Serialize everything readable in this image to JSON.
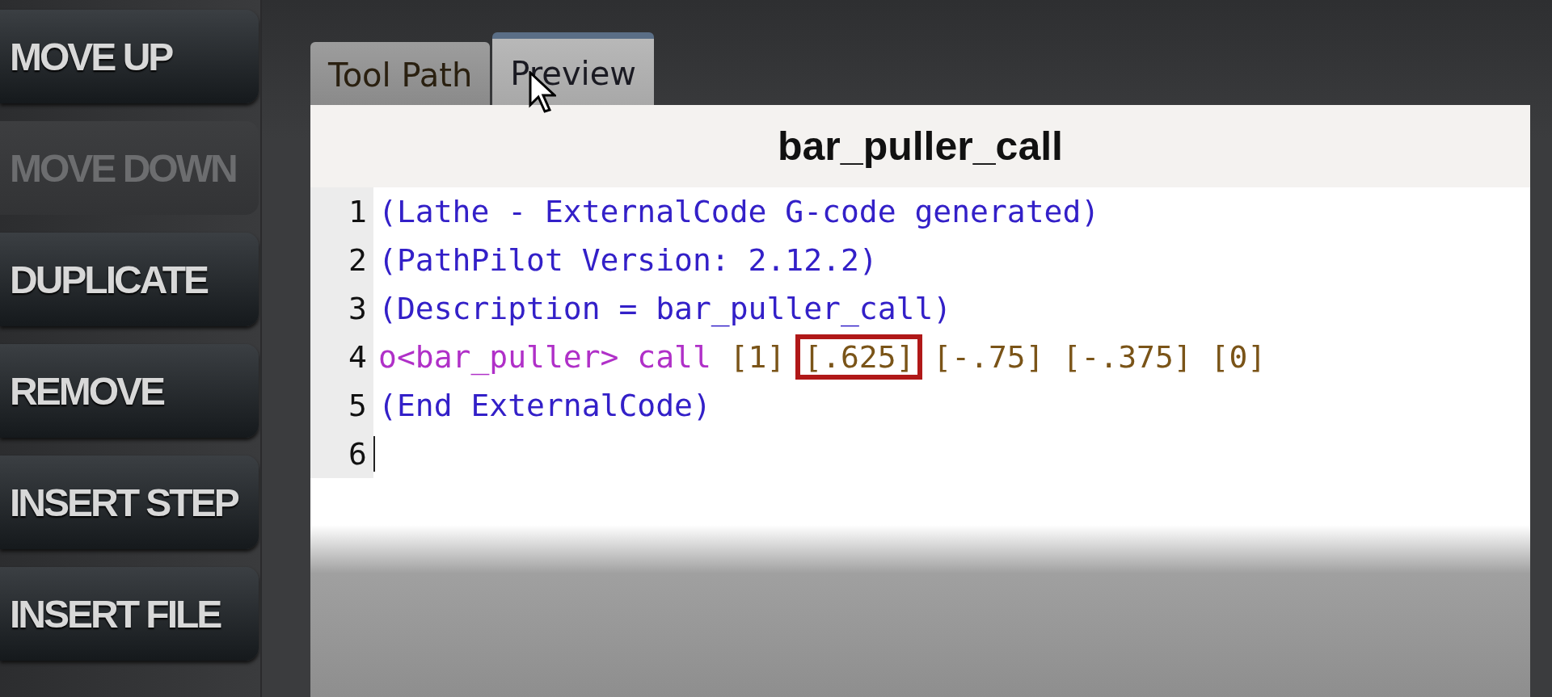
{
  "sidebar": {
    "buttons": [
      {
        "label": "MOVE UP",
        "disabled": false
      },
      {
        "label": "MOVE DOWN",
        "disabled": true
      },
      {
        "label": "DUPLICATE",
        "disabled": false
      },
      {
        "label": "REMOVE",
        "disabled": false
      },
      {
        "label": "INSERT STEP",
        "disabled": false
      },
      {
        "label": "INSERT FILE",
        "disabled": false
      }
    ]
  },
  "tabs": [
    {
      "label": "Tool Path",
      "selected": false
    },
    {
      "label": "Preview",
      "selected": true
    }
  ],
  "preview": {
    "title": "bar_puller_call",
    "lines": [
      {
        "number": "1",
        "cursor": false,
        "segments": [
          {
            "kind": "comment",
            "text": "(Lathe - ExternalCode G-code generated)",
            "highlighted": false
          }
        ]
      },
      {
        "number": "2",
        "cursor": false,
        "segments": [
          {
            "kind": "comment",
            "text": "(PathPilot Version: 2.12.2)",
            "highlighted": false
          }
        ]
      },
      {
        "number": "3",
        "cursor": false,
        "segments": [
          {
            "kind": "comment",
            "text": "(Description = bar_puller_call)",
            "highlighted": false
          }
        ]
      },
      {
        "number": "4",
        "cursor": false,
        "segments": [
          {
            "kind": "call",
            "text": "o<bar_puller> call",
            "highlighted": false
          },
          {
            "kind": "param",
            "text": " [1] ",
            "highlighted": false
          },
          {
            "kind": "param",
            "text": "[.625]",
            "highlighted": true
          },
          {
            "kind": "param",
            "text": " [-.75] [-.375] [0]",
            "highlighted": false
          }
        ]
      },
      {
        "number": "5",
        "cursor": false,
        "segments": [
          {
            "kind": "comment",
            "text": "(End ExternalCode)",
            "highlighted": false
          }
        ]
      },
      {
        "number": "6",
        "cursor": true
      }
    ]
  }
}
